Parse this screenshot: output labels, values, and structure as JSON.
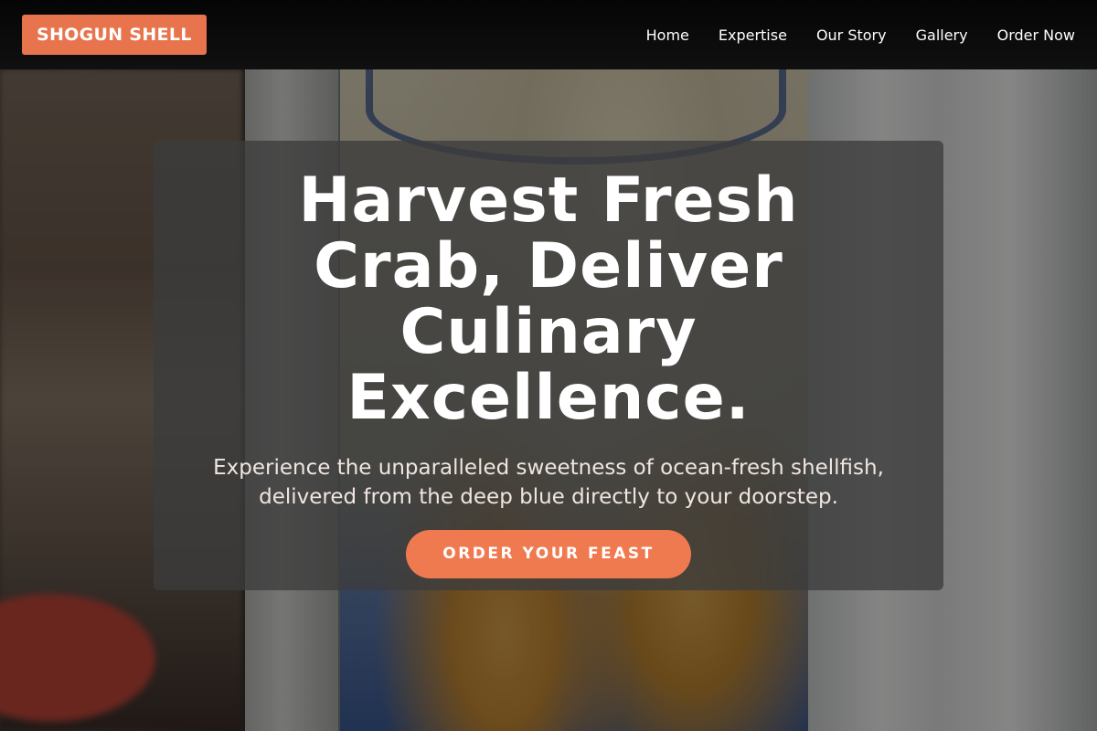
{
  "header": {
    "logo_text": "SHOGUN SHELL",
    "nav": [
      {
        "label": "Home"
      },
      {
        "label": "Expertise"
      },
      {
        "label": "Our Story"
      },
      {
        "label": "Gallery"
      },
      {
        "label": "Order Now"
      }
    ]
  },
  "hero": {
    "title": "Harvest Fresh Crab, Deliver Culinary Excellence.",
    "subtitle": "Experience the unparalleled sweetness of ocean-fresh shellfish, delivered from the deep blue directly to your doorstep.",
    "cta_label": "ORDER YOUR FEAST"
  },
  "colors": {
    "accent": "#e8744e",
    "cta": "#f07a50",
    "header_bg": "#0a0a0a",
    "card_bg": "rgba(60,60,60,0.78)"
  }
}
